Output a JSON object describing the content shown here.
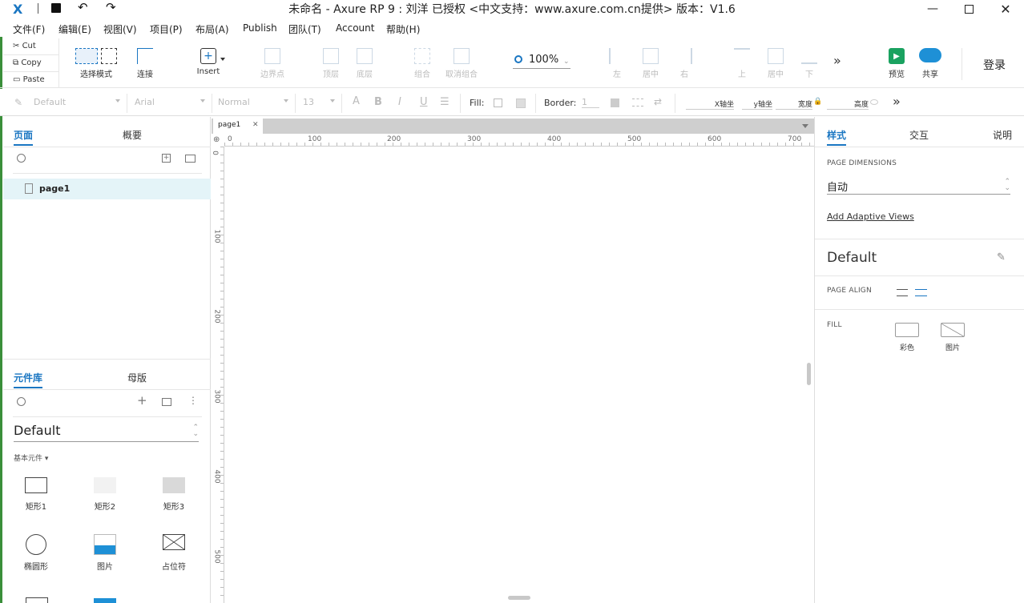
{
  "window": {
    "title": "未命名 - Axure RP 9 : 刘洋 已授权    <中文支持：www.axure.com.cn提供> 版本：V1.6"
  },
  "menu": [
    "文件(F)",
    "编辑(E)",
    "视图(V)",
    "项目(P)",
    "布局(A)",
    "Publish",
    "团队(T)",
    "Account",
    "帮助(H)"
  ],
  "clipboard": {
    "cut": "Cut",
    "copy": "Copy",
    "paste": "Paste"
  },
  "toolbar": {
    "select_mode": "选择模式",
    "connect": "连接",
    "insert": "Insert",
    "points": "边界点",
    "top": "顶层",
    "bottom": "底层",
    "group": "组合",
    "ungroup": "取消组合",
    "zoom": "100%",
    "align_left": "左",
    "align_center": "居中",
    "align_right": "右",
    "align_top": "上",
    "align_middle": "居中",
    "align_bottom": "下",
    "preview": "预览",
    "share": "共享",
    "login": "登录"
  },
  "format": {
    "style": "Default",
    "font": "Arial",
    "weight": "Normal",
    "size": "13",
    "fill_label": "Fill:",
    "border_label": "Border:",
    "border_value": "1",
    "x_label": "X轴坐",
    "y_label": "y轴坐",
    "w_label": "宽度",
    "h_label": "高度"
  },
  "left": {
    "tab_pages": "页面",
    "tab_outline": "概要",
    "page_item": "page1",
    "tab_library": "元件库",
    "tab_masters": "母版",
    "library_select": "Default",
    "section": "基本元件",
    "widgets": [
      "矩形1",
      "矩形2",
      "矩形3",
      "椭圆形",
      "图片",
      "占位符"
    ]
  },
  "canvas": {
    "tab": "page1",
    "hruler": [
      "0",
      "100",
      "200",
      "300",
      "400",
      "500",
      "600",
      "700"
    ],
    "vruler": [
      "0",
      "100",
      "200",
      "300",
      "400",
      "500"
    ]
  },
  "right": {
    "tab_style": "样式",
    "tab_interact": "交互",
    "tab_notes": "说明",
    "page_dimensions": "PAGE DIMENSIONS",
    "dimension_value": "自动",
    "adaptive": "Add Adaptive Views",
    "style_name": "Default",
    "page_align": "PAGE ALIGN",
    "fill": "FILL",
    "fill_color": "彩色",
    "fill_image": "图片"
  },
  "colors": {
    "accent": "#1a76c2",
    "preview_green": "#1aa260",
    "share_blue": "#1e90d6"
  }
}
